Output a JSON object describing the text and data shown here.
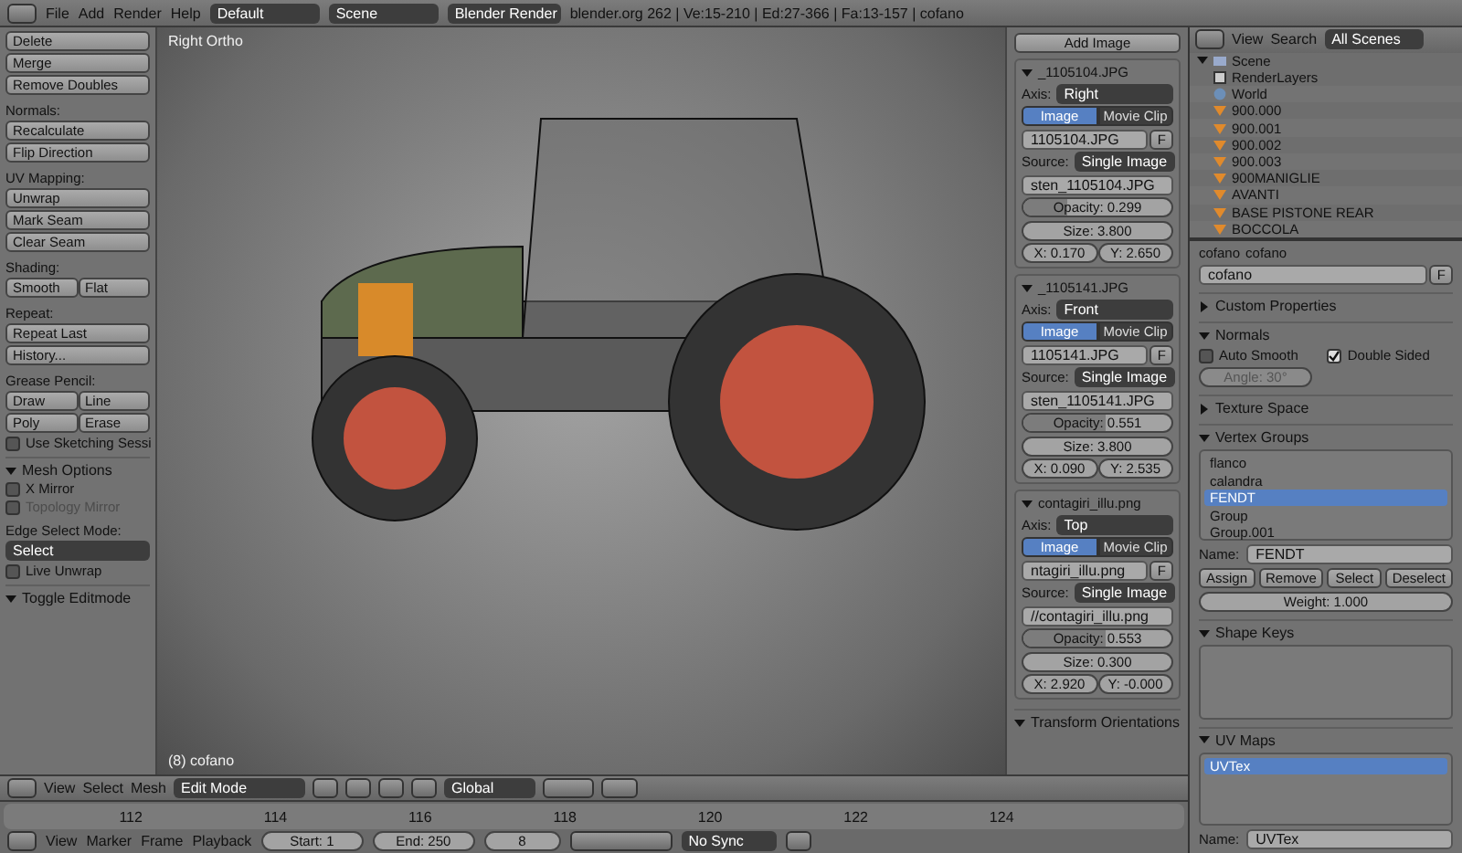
{
  "top_bar": {
    "menus": [
      "File",
      "Add",
      "Render",
      "Help"
    ],
    "layout": "Default",
    "scene": "Scene",
    "engine": "Blender Render",
    "stats": "blender.org 262 | Ve:15-210 | Ed:27-366 | Fa:13-157 | cofano"
  },
  "tool_shelf": {
    "items": [
      {
        "kind": "button",
        "label": "Delete"
      },
      {
        "kind": "button",
        "label": "Merge"
      },
      {
        "kind": "button",
        "label": "Remove Doubles"
      },
      {
        "kind": "label",
        "text": "Normals:"
      },
      {
        "kind": "button",
        "label": "Recalculate"
      },
      {
        "kind": "button",
        "label": "Flip Direction"
      },
      {
        "kind": "label",
        "text": "UV Mapping:"
      },
      {
        "kind": "button",
        "label": "Unwrap"
      },
      {
        "kind": "button",
        "label": "Mark Seam"
      },
      {
        "kind": "button",
        "label": "Clear Seam"
      },
      {
        "kind": "label",
        "text": "Shading:"
      },
      {
        "kind": "pair",
        "labels": [
          "Smooth",
          "Flat"
        ]
      },
      {
        "kind": "label",
        "text": "Repeat:"
      },
      {
        "kind": "button",
        "label": "Repeat Last"
      },
      {
        "kind": "button",
        "label": "History..."
      },
      {
        "kind": "label",
        "text": "Grease Pencil:"
      },
      {
        "kind": "pair",
        "labels": [
          "Draw",
          "Line"
        ]
      },
      {
        "kind": "pair",
        "labels": [
          "Poly",
          "Erase"
        ]
      },
      {
        "kind": "checkbox",
        "label": "Use Sketching Sessi",
        "checked": false,
        "disabled": false
      },
      {
        "kind": "header",
        "label": "Mesh Options",
        "expanded": true
      },
      {
        "kind": "checkbox",
        "label": "X Mirror",
        "checked": false,
        "disabled": false
      },
      {
        "kind": "checkbox",
        "label": "Topology Mirror",
        "checked": false,
        "disabled": true
      },
      {
        "kind": "label",
        "text": "Edge Select Mode:"
      },
      {
        "kind": "dropdown",
        "value": "Select"
      },
      {
        "kind": "checkbox",
        "label": "Live Unwrap",
        "checked": false,
        "disabled": false
      },
      {
        "kind": "header",
        "label": "Toggle Editmode",
        "expanded": true
      }
    ]
  },
  "viewport": {
    "view_name": "Right Ortho",
    "object_label": "(8) cofano"
  },
  "viewport_header": {
    "menus": [
      "View",
      "Select",
      "Mesh"
    ],
    "mode": "Edit Mode",
    "orientation": "Global"
  },
  "timeline": {
    "ruler": [
      "112",
      "114",
      "116",
      "118",
      "120",
      "122",
      "124"
    ],
    "menus": [
      "View",
      "Marker",
      "Frame",
      "Playback"
    ],
    "start": "Start: 1",
    "end": "End: 250",
    "frame": "8",
    "sync": "No Sync"
  },
  "background_images": {
    "add_button": "Add Image",
    "images": [
      {
        "name": "_1105104.JPG",
        "axis_label": "Axis:",
        "axis": "Right",
        "tabs": [
          {
            "label": "Image",
            "selected": true
          },
          {
            "label": "Movie Clip",
            "selected": false
          }
        ],
        "file": "1105104.JPG",
        "file_button": "F",
        "source_label": "Source:",
        "source": "Single Image",
        "path": "sten_1105104.JPG",
        "opacity": "Opacity: 0.299",
        "level": 0.299,
        "size": "Size: 3.800",
        "x": "X: 0.170",
        "y": "Y: 2.650"
      },
      {
        "name": "_1105141.JPG",
        "axis_label": "Axis:",
        "axis": "Front",
        "tabs": [
          {
            "label": "Image",
            "selected": true
          },
          {
            "label": "Movie Clip",
            "selected": false
          }
        ],
        "file": "1105141.JPG",
        "file_button": "F",
        "source_label": "Source:",
        "source": "Single Image",
        "path": "sten_1105141.JPG",
        "opacity": "Opacity: 0.551",
        "level": 0.551,
        "size": "Size: 3.800",
        "x": "X: 0.090",
        "y": "Y: 2.535"
      },
      {
        "name": "contagiri_illu.png",
        "axis_label": "Axis:",
        "axis": "Top",
        "tabs": [
          {
            "label": "Image",
            "selected": true
          },
          {
            "label": "Movie Clip",
            "selected": false
          }
        ],
        "file": "ntagiri_illu.png",
        "file_button": "F",
        "source_label": "Source:",
        "source": "Single Image",
        "path": "//contagiri_illu.png",
        "opacity": "Opacity: 0.553",
        "level": 0.553,
        "size": "Size: 0.300",
        "x": "X: 2.920",
        "y": "Y: -0.000"
      }
    ],
    "footer": "Transform Orientations"
  },
  "outliner": {
    "menus": [
      "View",
      "Search"
    ],
    "filter": "All Scenes",
    "tree": [
      {
        "name": "Scene",
        "expanded": true,
        "children": [
          {
            "name": "RenderLayers",
            "kind": "layers"
          },
          {
            "name": "World",
            "kind": "world"
          },
          {
            "name": "900.000",
            "kind": "object"
          },
          {
            "name": "900.001",
            "kind": "object"
          },
          {
            "name": "900.002",
            "kind": "object"
          },
          {
            "name": "900.003",
            "kind": "object"
          },
          {
            "name": "900MANIGLIE",
            "kind": "object"
          },
          {
            "name": "AVANTI",
            "kind": "object"
          },
          {
            "name": "BASE PISTONE REAR",
            "kind": "object"
          },
          {
            "name": "BOCCOLA",
            "kind": "object"
          }
        ]
      }
    ]
  },
  "properties": {
    "breadcrumb": [
      "cofano",
      "cofano"
    ],
    "mesh_name": "cofano",
    "mesh_button": "F",
    "custom_properties": {
      "label": "Custom Properties",
      "expanded": false
    },
    "normals": {
      "label": "Normals",
      "expanded": true,
      "auto_smooth": {
        "label": "Auto Smooth",
        "checked": false
      },
      "double_sided": {
        "label": "Double Sided",
        "checked": true
      },
      "angle": "Angle: 30°"
    },
    "texture_space": {
      "label": "Texture Space",
      "expanded": false
    },
    "vertex_groups": {
      "label": "Vertex Groups",
      "expanded": true,
      "items": [
        {
          "name": "flanco",
          "selected": false
        },
        {
          "name": "calandra",
          "selected": false
        },
        {
          "name": "FENDT",
          "selected": true
        },
        {
          "name": "Group",
          "selected": false
        },
        {
          "name": "Group.001",
          "selected": false
        }
      ],
      "name_label": "Name:",
      "name": "FENDT",
      "buttons": [
        "Assign",
        "Remove",
        "Select",
        "Deselect"
      ],
      "weight": "Weight: 1.000"
    },
    "shape_keys": {
      "label": "Shape Keys",
      "expanded": true
    },
    "uv_maps": {
      "label": "UV Maps",
      "expanded": true,
      "items": [
        {
          "name": "UVTex",
          "selected": true
        }
      ],
      "name_label": "Name:",
      "name": "UVTex"
    }
  }
}
